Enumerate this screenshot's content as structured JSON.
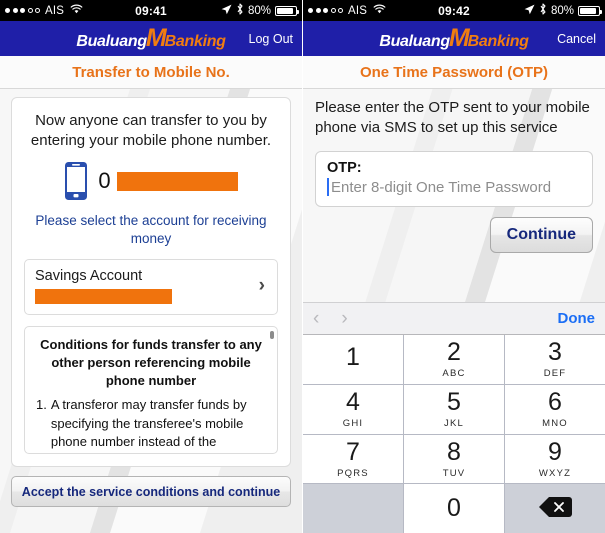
{
  "screens": [
    {
      "statusbar": {
        "signal_filled": 3,
        "signal_empty": 2,
        "carrier": "AIS",
        "wifi_icon": "wifi-icon",
        "time": "09:41",
        "location_icon": "location-arrow-icon",
        "bluetooth_icon": "bluetooth-icon",
        "battery_percent": "80%",
        "battery_icon": "battery-icon"
      },
      "brand": {
        "logo_part1": "Bualuang",
        "logo_part2": "M",
        "logo_part3": "Banking",
        "nav_action": "Log Out"
      },
      "page_title": "Transfer to Mobile No.",
      "intro": "Now anyone can transfer to you by entering your mobile phone number.",
      "phone_icon": "mobile-phone-icon",
      "phone_prefix": "0",
      "phone_redacted": true,
      "select_message": "Please select the account for receiving money",
      "account": {
        "name": "Savings Account",
        "number_redacted": true,
        "chevron": "›"
      },
      "conditions": {
        "title": "Conditions for funds transfer to any other person referencing mobile phone number",
        "items": [
          {
            "number": "1.",
            "text": "A transferor may transfer funds by specifying the transferee's mobile phone number instead of the transferee's account number to"
          }
        ]
      },
      "accept_button": "Accept the service conditions and continue"
    },
    {
      "statusbar": {
        "signal_filled": 3,
        "signal_empty": 2,
        "carrier": "AIS",
        "wifi_icon": "wifi-icon",
        "time": "09:42",
        "location_icon": "location-arrow-icon",
        "bluetooth_icon": "bluetooth-icon",
        "battery_percent": "80%",
        "battery_icon": "battery-icon"
      },
      "brand": {
        "logo_part1": "Bualuang",
        "logo_part2": "M",
        "logo_part3": "Banking",
        "nav_action": "Cancel"
      },
      "page_title": "One Time Password (OTP)",
      "instruction": "Please enter the OTP sent to your mobile phone via SMS to set up this service",
      "otp": {
        "label": "OTP:",
        "value": "",
        "placeholder": "Enter 8-digit One Time Password"
      },
      "continue_button": "Continue",
      "keyboard_bar": {
        "prev_icon": "chevron-left-icon",
        "next_icon": "chevron-right-icon",
        "done_label": "Done"
      },
      "keypad": [
        {
          "num": "1",
          "letters": ""
        },
        {
          "num": "2",
          "letters": "ABC"
        },
        {
          "num": "3",
          "letters": "DEF"
        },
        {
          "num": "4",
          "letters": "GHI"
        },
        {
          "num": "5",
          "letters": "JKL"
        },
        {
          "num": "6",
          "letters": "MNO"
        },
        {
          "num": "7",
          "letters": "PQRS"
        },
        {
          "num": "8",
          "letters": "TUV"
        },
        {
          "num": "9",
          "letters": "WXYZ"
        },
        {
          "num": "",
          "letters": "",
          "type": "blank"
        },
        {
          "num": "0",
          "letters": ""
        },
        {
          "num": "",
          "letters": "",
          "type": "delete",
          "icon": "backspace-icon"
        }
      ]
    }
  ],
  "colors": {
    "brand_blue": "#1f1fa8",
    "brand_orange": "#f07d11",
    "title_orange": "#e8731a",
    "link_blue": "#1c3f94",
    "redact_orange": "#f0730d",
    "done_blue": "#1b6ef5"
  }
}
